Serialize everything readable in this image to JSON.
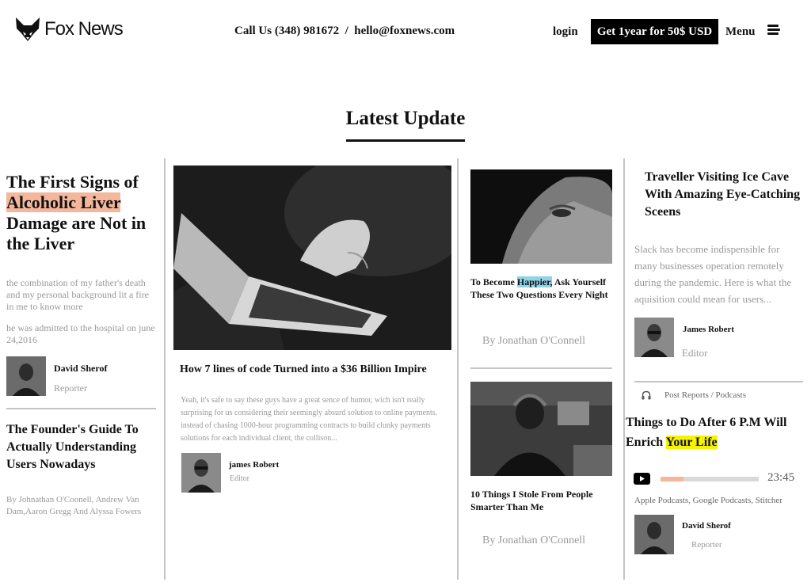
{
  "header": {
    "logo_text": "Fox News",
    "contact": "Call Us (348) 981672  /  hello@foxnews.com",
    "login": "login",
    "cta": "Get 1year for 50$ USD",
    "menu": "Menu"
  },
  "section_title": "Latest Update",
  "col1": {
    "headline_pre": "The First Signs of",
    "headline_highlight": "Alcoholic Liver",
    "headline_post": "Damage are Not in the Liver",
    "excerpt1": "the combination of my father's death and my personal background lit a fire in me to know more",
    "excerpt2": "he was admitted to the hospital on june 24,2016",
    "author_name": "David Sherof",
    "author_role": "Reporter",
    "story2_title": "The Founder's Guide To Actually Understanding Users Nowadays",
    "story2_byline": "By Johnathan O'Coonell, Andrew Van Dam,Aaron Gregg And Alyssa Fowers"
  },
  "col2": {
    "title": "How 7 lines of code Turned into a $36 Billion Impire",
    "excerpt": "Yeah, it's safe to say these guys have a great sence of humor, wich isn't really surprising for us considering their seemingly absurd solution to online payments. instead of chasing 1000-hour programming contracts to build clunky payments solutions for each individual client, the collison...",
    "author_name": "james Robert",
    "author_role": "Editor"
  },
  "col3": {
    "story1_pre": "To Become",
    "story1_highlight": "Happier,",
    "story1_post": "Ask Yourself These Two Questions Every Night",
    "story1_byline": "By Jonathan O'Connell",
    "story2_title": "10 Things I Stole From People Smarter Than Me",
    "story2_byline": "By Jonathan O'Connell"
  },
  "col4": {
    "title": "Traveller Visiting Ice Cave With Amazing Eye-Catching Sceens",
    "excerpt": "Slack has become indispensible for many businesses operation remotely during the pandemic. Here is what the aquisition could mean for users...",
    "author_name": "James Robert",
    "author_role": "Editor",
    "podcast_category": "Post Reports / Podcasts",
    "podcast_title_pre": "Things to Do After 6 P.M Will Enrich",
    "podcast_title_highlight": "Your Life",
    "duration": "23:45",
    "progress": 0.23,
    "platforms": "Apple Podcasts, Google Podcasts, Stitcher",
    "host_name": "David Sherof",
    "host_role": "Reporter"
  },
  "icons": {
    "logo": "fox-head-icon",
    "menu": "hamburger-icon",
    "headphones": "headphones-icon",
    "play": "play-icon"
  },
  "colors": {
    "highlight_peach": "#f4b79b",
    "highlight_blue": "#8ed4e6",
    "highlight_yellow": "#f6f300",
    "progress_fill": "#f4b79b",
    "progress_track": "#d9d9d9"
  }
}
